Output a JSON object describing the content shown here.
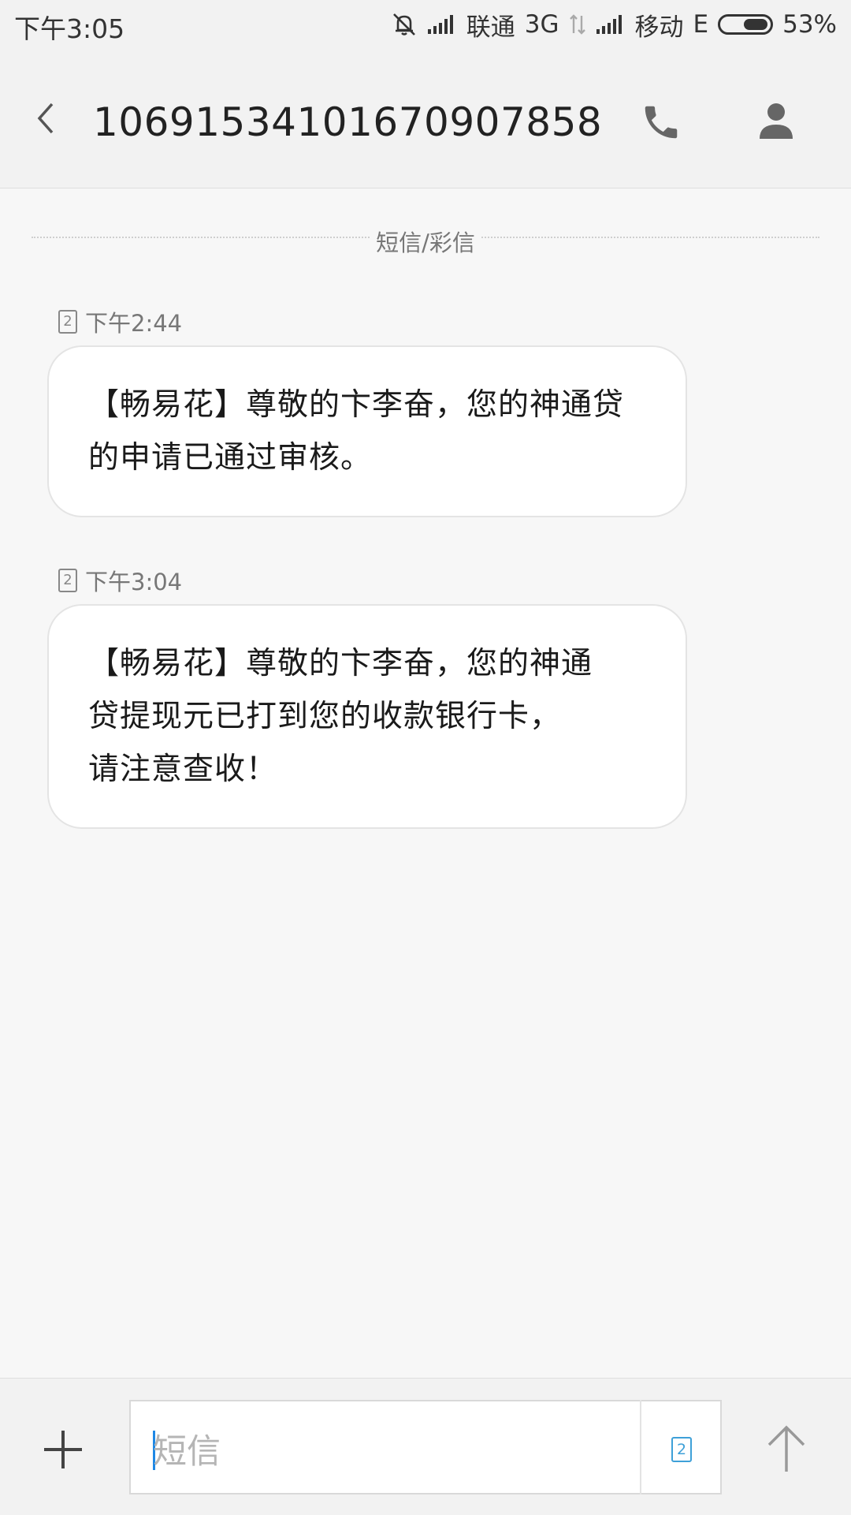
{
  "status_bar": {
    "time": "下午3:05",
    "carrier1": "联通",
    "network1": "3G",
    "carrier2": "移动",
    "network2": "E",
    "battery": "53%",
    "battery_level": 0.53,
    "icons": [
      "mute-icon",
      "signal-icon",
      "data-arrows-icon",
      "signal-icon",
      "battery-icon"
    ]
  },
  "header": {
    "title": "10691534101670907858",
    "icons": [
      "back-arrow-icon",
      "phone-icon",
      "person-icon"
    ]
  },
  "conversation": {
    "separator_label": "短信/彩信",
    "messages": [
      {
        "sim": "2",
        "time": "下午2:44",
        "text": "【畅易花】尊敬的卞李奋，您的神通贷\n的申请已通过审核。"
      },
      {
        "sim": "2",
        "time": "下午3:04",
        "text": "【畅易花】尊敬的卞李奋，您的神通\n贷提现元已打到您的收款银行卡，\n请注意查收！"
      }
    ]
  },
  "compose": {
    "placeholder": "短信",
    "sim": "2",
    "icons": [
      "plus-icon",
      "sim-card-icon",
      "send-arrow-icon"
    ]
  },
  "colors": {
    "background": "#f7f7f7",
    "bar": "#f2f2f2",
    "bubble": "#ffffff",
    "accent": "#3ea0d8"
  }
}
